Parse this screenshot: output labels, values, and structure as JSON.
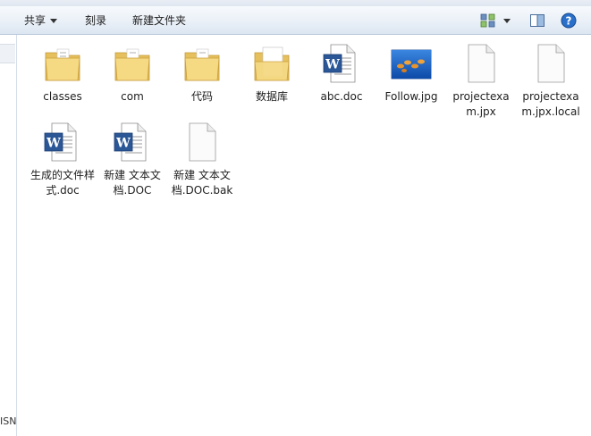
{
  "window": {
    "title_fragments": [
      "",
      ""
    ]
  },
  "toolbar": {
    "share_label": "共享",
    "burn_label": "刻录",
    "new_folder_label": "新建文件夹"
  },
  "nav": {
    "partial_text": "ISN"
  },
  "files": [
    {
      "name": "classes",
      "type": "folder",
      "icon": "folder-icon"
    },
    {
      "name": "com",
      "type": "folder",
      "icon": "folder-icon"
    },
    {
      "name": "代码",
      "type": "folder",
      "icon": "folder-icon"
    },
    {
      "name": "数据库",
      "type": "folder",
      "icon": "folder-doc-icon"
    },
    {
      "name": "abc.doc",
      "type": "word",
      "icon": "word-doc-icon"
    },
    {
      "name": "Follow.jpg",
      "type": "image",
      "icon": "image-thumbnail-icon"
    },
    {
      "name": "projectexam.jpx",
      "type": "file",
      "icon": "blank-file-icon"
    },
    {
      "name": "projectexam.jpx.local",
      "type": "file",
      "icon": "blank-file-icon"
    },
    {
      "name": "生成的文件样式.doc",
      "type": "word",
      "icon": "word-doc-icon"
    },
    {
      "name": "新建 文本文档.DOC",
      "type": "word",
      "icon": "word-doc-icon"
    },
    {
      "name": "新建 文本文档.DOC.bak",
      "type": "file",
      "icon": "blank-file-icon"
    }
  ],
  "colors": {
    "toolbar_top": "#f7fafd",
    "toolbar_bottom": "#dce6f2",
    "folder": "#f2d27a",
    "word_blue": "#2b5797",
    "help_blue": "#2a6fc9"
  }
}
